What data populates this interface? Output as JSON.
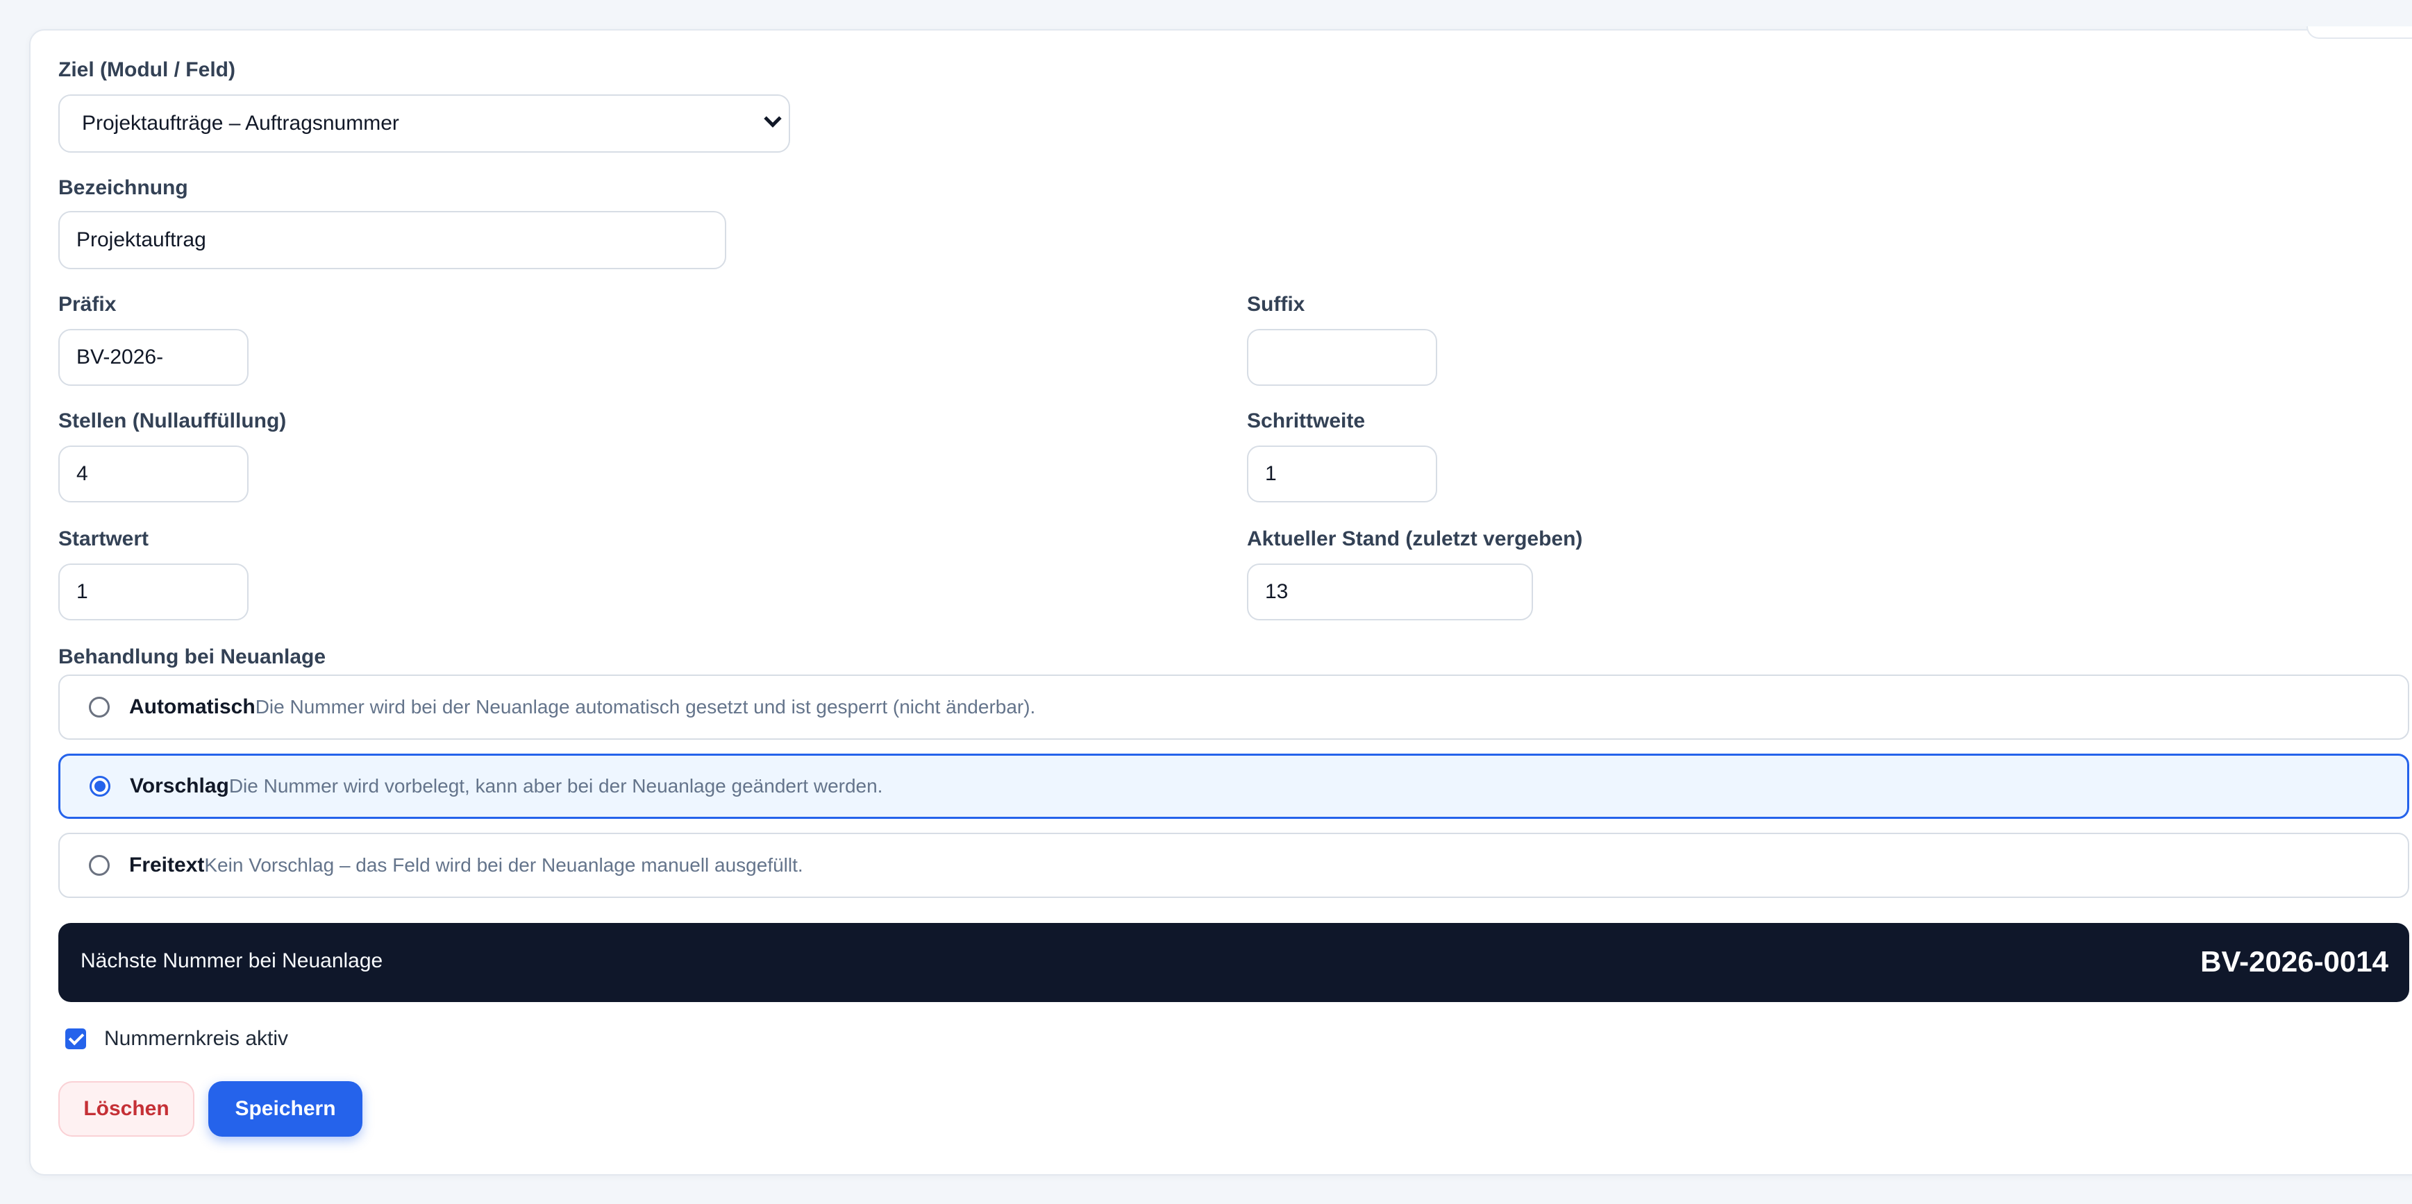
{
  "form": {
    "target": {
      "label": "Ziel (Modul / Feld)",
      "value": "Projektaufträge – Auftragsnummer"
    },
    "designation": {
      "label": "Bezeichnung",
      "value": "Projektauftrag"
    },
    "prefix": {
      "label": "Präfix",
      "value": "BV-2026-"
    },
    "suffix": {
      "label": "Suffix",
      "value": ""
    },
    "digits": {
      "label": "Stellen (Nullauffüllung)",
      "value": "4"
    },
    "step": {
      "label": "Schrittweite",
      "value": "1"
    },
    "start": {
      "label": "Startwert",
      "value": "1"
    },
    "current": {
      "label": "Aktueller Stand (zuletzt vergeben)",
      "value": "13"
    },
    "handling": {
      "label": "Behandlung bei Neuanlage",
      "selected": "Vorschlag",
      "options": [
        {
          "title": "Automatisch",
          "description": "Die Nummer wird bei der Neuanlage automatisch gesetzt und ist gesperrt (nicht änderbar)."
        },
        {
          "title": "Vorschlag",
          "description": "Die Nummer wird vorbelegt, kann aber bei der Neuanlage geändert werden."
        },
        {
          "title": "Freitext",
          "description": "Kein Vorschlag – das Feld wird bei der Neuanlage manuell ausgefüllt."
        }
      ]
    },
    "next_number": {
      "label": "Nächste Nummer bei Neuanlage",
      "value": "BV-2026-0014"
    },
    "active": {
      "label": "Nummernkreis aktiv",
      "checked": true
    },
    "buttons": {
      "delete": "Löschen",
      "save": "Speichern"
    }
  },
  "colors": {
    "accent": "#2563eb",
    "banner": "#0f172a",
    "danger": "#c53036"
  }
}
